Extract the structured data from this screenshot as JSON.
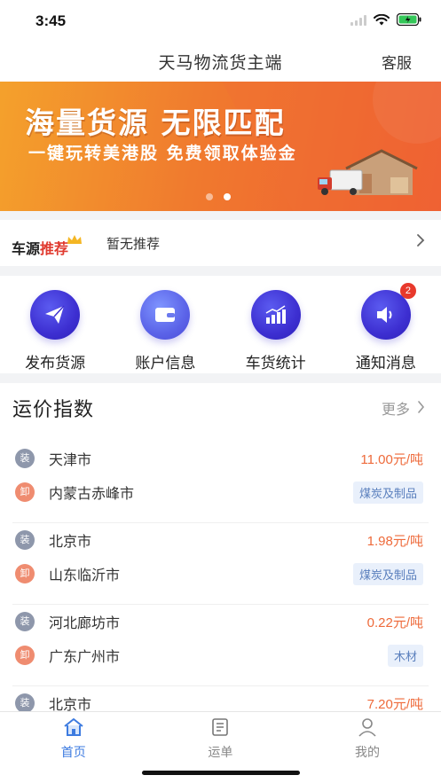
{
  "status": {
    "time": "3:45"
  },
  "nav": {
    "title": "天马物流货主端",
    "service_label": "客服"
  },
  "banner": {
    "title": "海量货源 无限匹配",
    "subtitle": "一键玩转美港股 免费领取体验金",
    "slide_count": 2,
    "active_slide": 2
  },
  "recommend": {
    "logo_part1": "车源",
    "logo_part2": "推荐",
    "text": "暂无推荐",
    "arrow_icon": "chevron-right-icon"
  },
  "menu": [
    {
      "label": "发布货源",
      "icon": "paper-plane-icon"
    },
    {
      "label": "账户信息",
      "icon": "wallet-icon"
    },
    {
      "label": "车货统计",
      "icon": "bar-chart-icon"
    },
    {
      "label": "通知消息",
      "icon": "speaker-icon",
      "badge": "2"
    }
  ],
  "freight": {
    "title": "运价指数",
    "more_label": "更多",
    "load_tag": "装",
    "unload_tag": "卸",
    "routes": [
      {
        "from": "天津市",
        "to": "内蒙古赤峰市",
        "price": "11.00元/吨",
        "cargo": "煤炭及制品"
      },
      {
        "from": "北京市",
        "to": "山东临沂市",
        "price": "1.98元/吨",
        "cargo": "煤炭及制品"
      },
      {
        "from": "河北廊坊市",
        "to": "广东广州市",
        "price": "0.22元/吨",
        "cargo": "木材"
      },
      {
        "from": "北京市",
        "to": "",
        "price": "7.20元/吨",
        "cargo": ""
      }
    ]
  },
  "tabs": [
    {
      "label": "首页",
      "icon": "home-icon",
      "active": true
    },
    {
      "label": "运单",
      "icon": "document-icon",
      "active": false
    },
    {
      "label": "我的",
      "icon": "user-icon",
      "active": false
    }
  ],
  "colors": {
    "accent": "#3d7be0",
    "price": "#ee6a3a",
    "menu_icon": "#3d2fd1",
    "badge": "#e8392c"
  }
}
